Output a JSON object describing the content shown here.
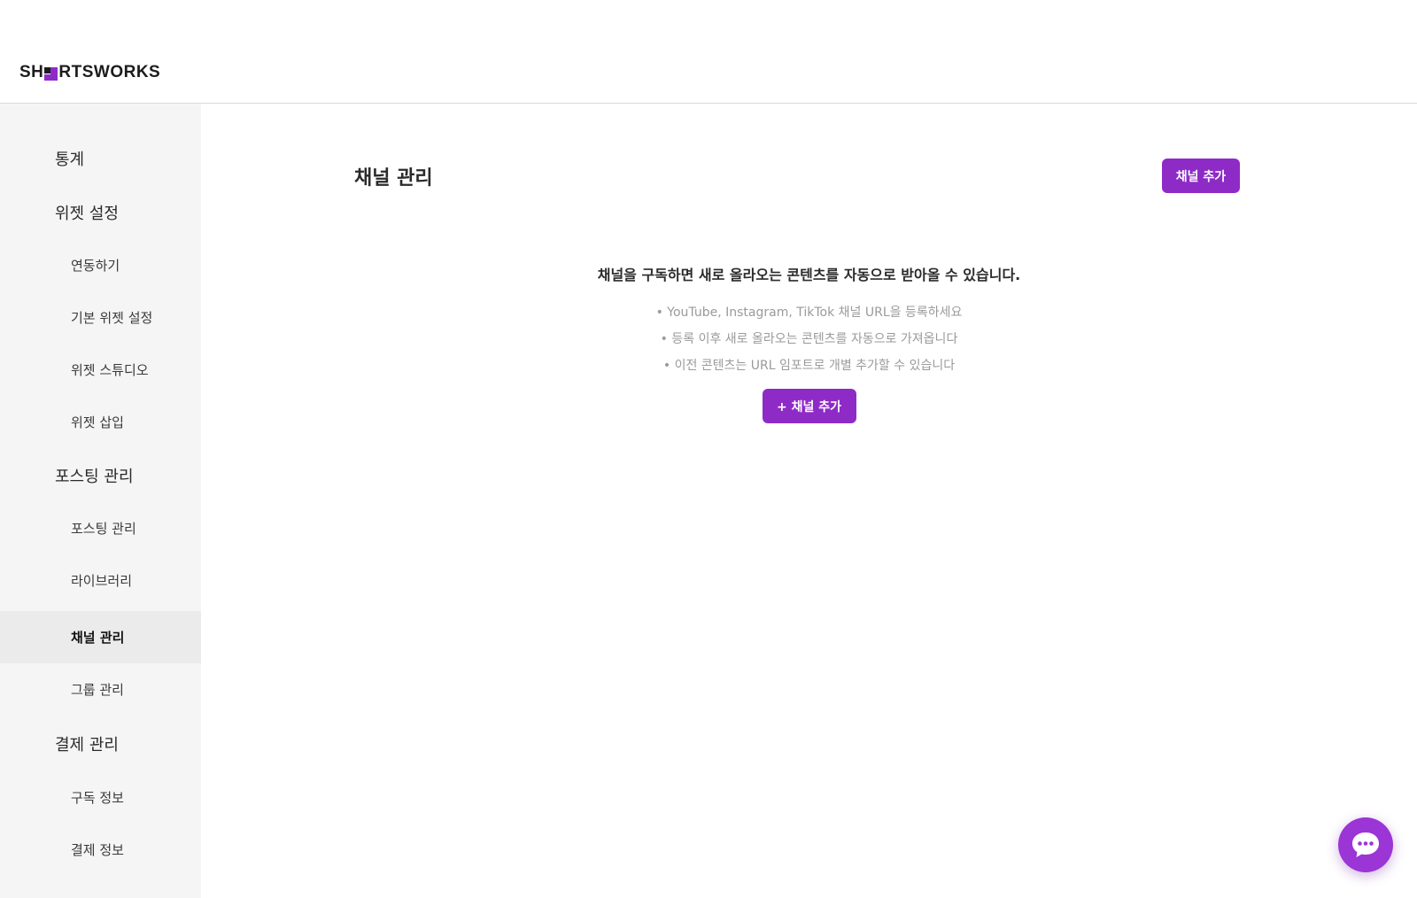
{
  "brand": {
    "logo_prefix": "SH",
    "logo_suffix": "RTSWORKS",
    "accent_color": "#8e2bc7"
  },
  "sidebar": {
    "items": [
      {
        "label": "통계",
        "level": "group"
      },
      {
        "label": "위젯 설정",
        "level": "group"
      },
      {
        "label": "연동하기",
        "level": "sub"
      },
      {
        "label": "기본 위젯 설정",
        "level": "sub"
      },
      {
        "label": "위젯 스튜디오",
        "level": "sub"
      },
      {
        "label": "위젯 삽입",
        "level": "sub"
      },
      {
        "label": "포스팅 관리",
        "level": "group"
      },
      {
        "label": "포스팅 관리",
        "level": "sub"
      },
      {
        "label": "라이브러리",
        "level": "sub"
      },
      {
        "label": "채널 관리",
        "level": "sub",
        "active": true
      },
      {
        "label": "그룹 관리",
        "level": "sub"
      },
      {
        "label": "결제 관리",
        "level": "group"
      },
      {
        "label": "구독 정보",
        "level": "sub"
      },
      {
        "label": "결제 정보",
        "level": "sub"
      }
    ]
  },
  "main": {
    "title": "채널 관리",
    "add_button_label": "채널 추가",
    "empty_state": {
      "title": "채널을 구독하면 새로 올라오는 콘텐츠를 자동으로 받아올 수 있습니다.",
      "hints": [
        "• YouTube, Instagram, TikTok 채널 URL을 등록하세요",
        "• 등록 이후 새로 올라오는 콘텐츠를 자동으로 가져옵니다",
        "• 이전 콘텐츠는 URL 임포트로 개별 추가할 수 있습니다"
      ],
      "button_label": "+ 채널 추가"
    }
  },
  "chat": {
    "icon": "chat-bubble-icon"
  }
}
